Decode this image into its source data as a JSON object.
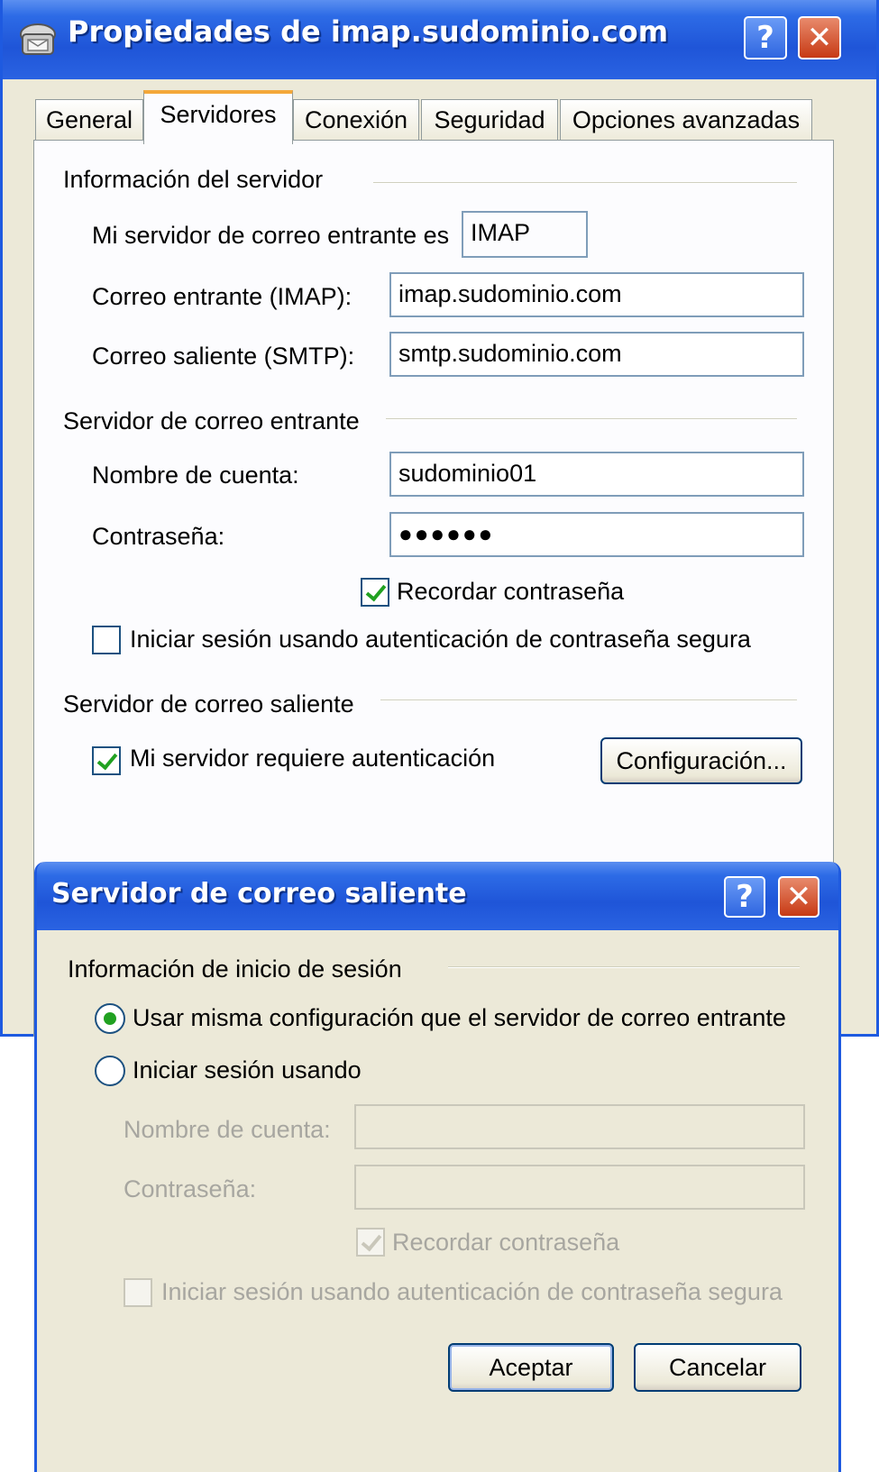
{
  "main_window": {
    "title": "Propiedades de imap.sudominio.com",
    "help_label": "?",
    "close_label": "✕",
    "tabs": [
      "General",
      "Servidores",
      "Conexión",
      "Seguridad",
      "Opciones avanzadas"
    ],
    "active_tab": "Servidores",
    "server_info": {
      "heading": "Información del servidor",
      "incoming_type_label": "Mi servidor de correo entrante es",
      "incoming_type_value": "IMAP",
      "incoming_label": "Correo entrante (IMAP):",
      "incoming_value": "imap.sudominio.com",
      "outgoing_label": "Correo saliente (SMTP):",
      "outgoing_value": "smtp.sudominio.com"
    },
    "incoming_server": {
      "heading": "Servidor de correo entrante",
      "account_label": "Nombre de cuenta:",
      "account_value": "sudominio01",
      "password_label": "Contraseña:",
      "password_value": "●●●●●●",
      "remember_label": "Recordar contraseña",
      "remember_checked": true,
      "spa_label": "Iniciar sesión usando autenticación de contraseña segura",
      "spa_checked": false
    },
    "outgoing_server": {
      "heading": "Servidor de correo saliente",
      "auth_label": "Mi servidor requiere autenticación",
      "auth_checked": true,
      "settings_button": "Configuración..."
    }
  },
  "dialog": {
    "title": "Servidor de correo saliente",
    "help_label": "?",
    "close_label": "✕",
    "heading": "Información de inicio de sesión",
    "option_same": "Usar misma configuración que el servidor de correo entrante",
    "option_login": "Iniciar sesión usando",
    "selected_option": "same",
    "account_label": "Nombre de cuenta:",
    "account_value": "",
    "password_label": "Contraseña:",
    "password_value": "",
    "remember_label": "Recordar contraseña",
    "remember_checked": true,
    "spa_label": "Iniciar sesión usando autenticación de contraseña segura",
    "spa_checked": false,
    "ok_button": "Aceptar",
    "cancel_button": "Cancelar"
  }
}
